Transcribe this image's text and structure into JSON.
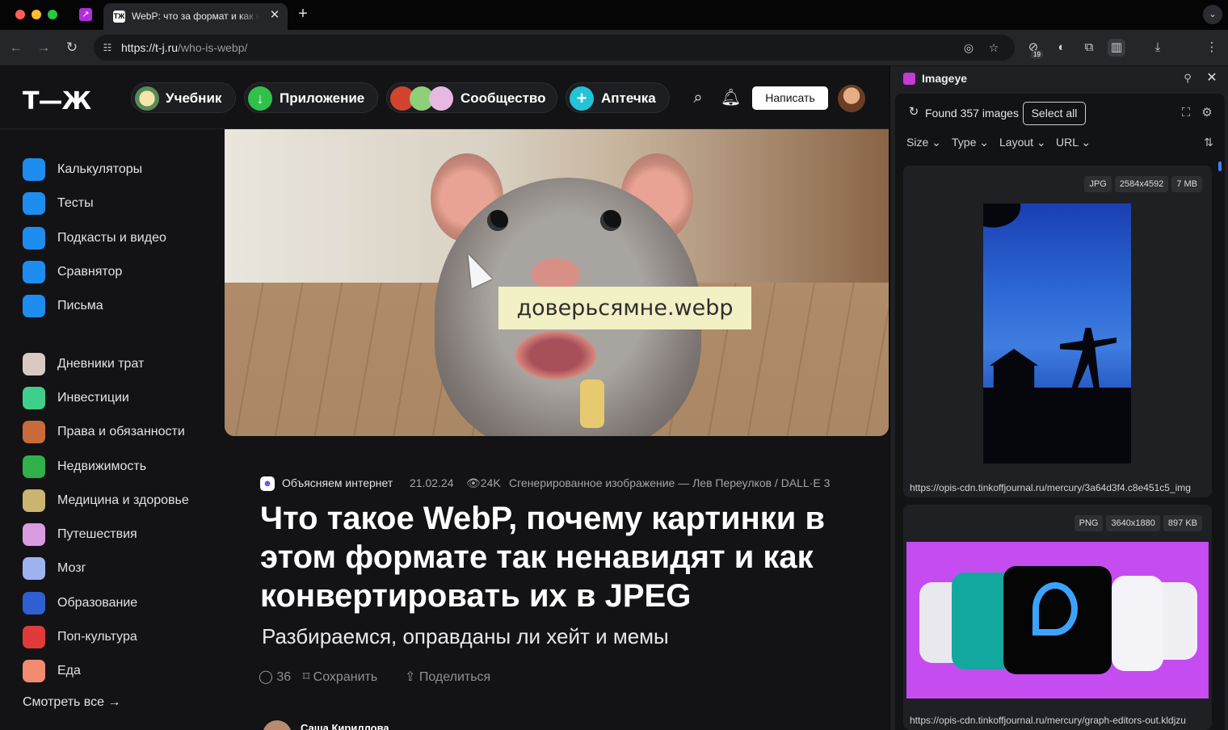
{
  "browser": {
    "tab_title": "WebP: что за формат и как к",
    "tab_favicon_text": "TЖ",
    "url_host": "https://t-j.ru",
    "url_path": "/who-is-webp/",
    "extension_badge": "19",
    "icons": {
      "back": "arrow-left-icon",
      "forward": "arrow-right-icon",
      "reload": "reload-icon",
      "site_info": "site-info-icon",
      "eye_off": "eye-off-icon",
      "bookmark": "star-icon",
      "extensions": "puzzle-icon",
      "side_panel": "side-panel-icon",
      "download": "download-icon",
      "menu": "kebab-menu-icon"
    }
  },
  "site": {
    "logo": "Т—Ж",
    "nav": [
      {
        "label": "Учебник",
        "icon": "textbook-icon"
      },
      {
        "label": "Приложение",
        "icon": "download-app-icon"
      },
      {
        "label": "Сообщество",
        "icon": "community-avatars-icon"
      },
      {
        "label": "Аптечка",
        "icon": "plus-medkit-icon"
      }
    ],
    "write_button": "Написать",
    "sidebar": [
      {
        "label": "Калькуляторы",
        "color": "#1e8df0"
      },
      {
        "label": "Тесты",
        "color": "#1e8df0"
      },
      {
        "label": "Подкасты и видео",
        "color": "#1e8df0"
      },
      {
        "label": "Сравнятор",
        "color": "#1e8df0"
      },
      {
        "label": "Письма",
        "color": "#1e8df0"
      },
      {
        "label": "Дневники трат",
        "color": "#d9c9c3"
      },
      {
        "label": "Инвестиции",
        "color": "#3fcf8a"
      },
      {
        "label": "Права и обязанности",
        "color": "#c86a3a"
      },
      {
        "label": "Недвижимость",
        "color": "#2fb04a"
      },
      {
        "label": "Медицина и здоровье",
        "color": "#c9b470"
      },
      {
        "label": "Путешествия",
        "color": "#d99be0"
      },
      {
        "label": "Мозг",
        "color": "#9fb2f0"
      },
      {
        "label": "Образование",
        "color": "#2f5fd0"
      },
      {
        "label": "Поп-культура",
        "color": "#e03a3a"
      },
      {
        "label": "Еда",
        "color": "#f08a70"
      }
    ],
    "see_all": "Смотреть все →",
    "hero_caption": "доверьсямне.webp",
    "article": {
      "rubric": "Объясняем интернет",
      "date": "21.02.24",
      "views": "24K",
      "credit": "Сгенерированное изображение — Лев Переулков / DALL·E 3",
      "title": "Что такое WebP, почему картинки в этом формате так ненавидят и как конвертировать их в JPEG",
      "subtitle": "Разбираемся, оправданы ли хейт и мемы",
      "comments": "36",
      "save": "Сохранить",
      "share": "Поделиться",
      "author": "Саша Кириллова"
    }
  },
  "imageye": {
    "title": "Imageye",
    "found": "Found 357 images",
    "select_all": "Select all",
    "filters": [
      "Size",
      "Type",
      "Layout",
      "URL"
    ],
    "images": [
      {
        "type": "JPG",
        "dimensions": "2584x4592",
        "size": "7 MB",
        "url": "https://opis-cdn.tinkoffjournal.ru/mercury/3a64d3f4.c8e451c5_img"
      },
      {
        "type": "PNG",
        "dimensions": "3640x1880",
        "size": "897 KB",
        "url": "https://opis-cdn.tinkoffjournal.ru/mercury/graph-editors-out.kldjzu"
      }
    ]
  }
}
